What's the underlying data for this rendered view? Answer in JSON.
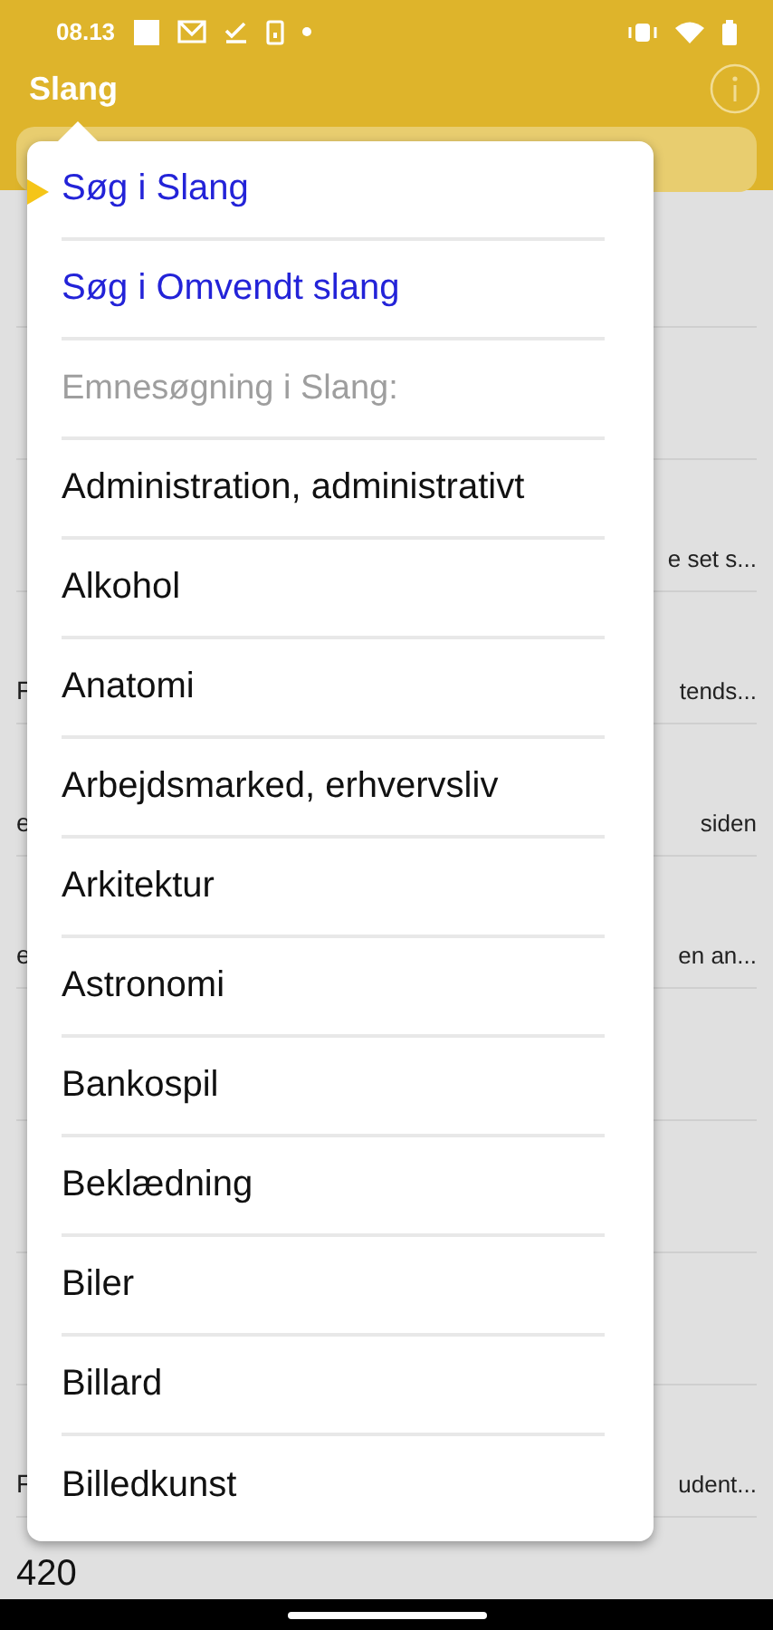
{
  "status_bar": {
    "time": "08.13"
  },
  "app_bar": {
    "title": "Slang"
  },
  "background_rows": [
    {
      "subtitle": "",
      "note": ""
    },
    {
      "subtitle": "",
      "note": ""
    },
    {
      "subtitle": "",
      "note": "e set s..."
    },
    {
      "subtitle": "F",
      "note": "tends..."
    },
    {
      "subtitle": "e",
      "note": "siden"
    },
    {
      "subtitle": "e",
      "note": "en an..."
    },
    {
      "subtitle": "",
      "note": ""
    },
    {
      "subtitle": "",
      "note": ""
    },
    {
      "subtitle": "",
      "note": ""
    },
    {
      "subtitle": "F",
      "note": "udent..."
    }
  ],
  "last_row_title": "420",
  "menu": {
    "items": [
      {
        "kind": "link",
        "label": "Søg i Slang",
        "selected": true
      },
      {
        "kind": "link",
        "label": "Søg i Omvendt slang",
        "selected": false
      },
      {
        "kind": "header",
        "label": "Emnesøgning i Slang:",
        "selected": false
      },
      {
        "kind": "topic",
        "label": "Administration, administrativt",
        "selected": false
      },
      {
        "kind": "topic",
        "label": "Alkohol",
        "selected": false
      },
      {
        "kind": "topic",
        "label": "Anatomi",
        "selected": false
      },
      {
        "kind": "topic",
        "label": "Arbejdsmarked, erhvervsliv",
        "selected": false
      },
      {
        "kind": "topic",
        "label": "Arkitektur",
        "selected": false
      },
      {
        "kind": "topic",
        "label": "Astronomi",
        "selected": false
      },
      {
        "kind": "topic",
        "label": "Bankospil",
        "selected": false
      },
      {
        "kind": "topic",
        "label": "Beklædning",
        "selected": false
      },
      {
        "kind": "topic",
        "label": "Biler",
        "selected": false
      },
      {
        "kind": "topic",
        "label": "Billard",
        "selected": false
      },
      {
        "kind": "topic",
        "label": "Billedkunst",
        "selected": false
      }
    ]
  }
}
